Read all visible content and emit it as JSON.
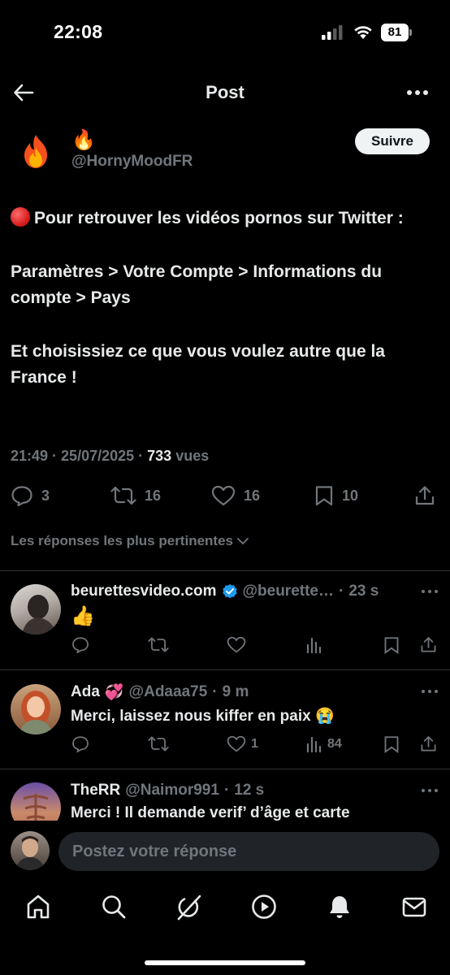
{
  "status_bar": {
    "time": "22:08",
    "battery": "81"
  },
  "header": {
    "title": "Post"
  },
  "post": {
    "author_name": "🔥",
    "author_handle": "@HornyMoodFR",
    "follow_label": "Suivre",
    "body": [
      "Pour retrouver les vidéos pornos sur Twitter :",
      "Paramètres > Votre Compte > Informations du compte > Pays",
      "Et choisissiez ce que vous voulez autre que la France !"
    ],
    "time": "21:49",
    "date": "25/07/2025",
    "views_count": "733",
    "views_label": "vues",
    "replies": "3",
    "reposts": "16",
    "likes": "16",
    "bookmarks": "10"
  },
  "sort_label": "Les réponses les plus pertinentes",
  "replies": [
    {
      "name": "beurettesvideo.com",
      "handle": "@beurette…",
      "time": "23 s",
      "text": "👍",
      "likes": "",
      "views": "",
      "verified": true
    },
    {
      "name": "Ada",
      "emoji": "💞",
      "handle": "@Adaaa75",
      "time": "9 m",
      "text": "Merci, laissez nous kiffer en paix 😭",
      "likes": "1",
      "views": "84"
    },
    {
      "name": "TheRR",
      "handle": "@Naimor991",
      "time": "12 s",
      "text": "Merci ! Il demande verif’ d’âge et carte"
    }
  ],
  "composer": {
    "placeholder": "Postez votre réponse"
  },
  "tabs": [
    "home-icon",
    "search-icon",
    "grok-icon",
    "video-icon",
    "notifications-icon",
    "messages-icon"
  ],
  "colors": {
    "background": "#000000",
    "text": "#e7e9ea",
    "secondary": "#71767b",
    "verified": "#1d9bf0",
    "divider": "#2f3336"
  }
}
